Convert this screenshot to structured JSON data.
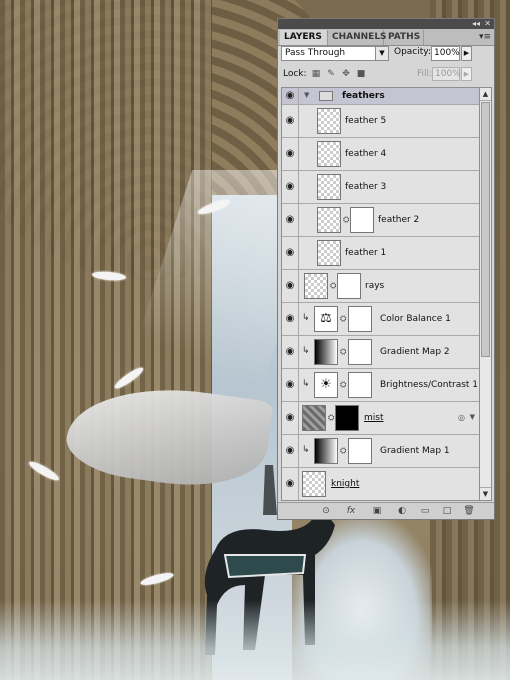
{
  "panel": {
    "tabs": [
      "LAYERS",
      "CHANNELS",
      "PATHS"
    ],
    "menu_icon": "▾≡",
    "topbar_icons": [
      "collapse-icon",
      "close-icon"
    ],
    "blend_mode": "Pass Through",
    "opacity_label": "Opacity:",
    "opacity_value": "100%",
    "lock_label": "Lock:",
    "lock_icons": [
      "lock-transparent-icon",
      "lock-image-icon",
      "lock-position-icon",
      "lock-all-icon"
    ],
    "fill_label": "Fill:",
    "fill_value": "100%",
    "bottom_icons": [
      "link-layers-icon",
      "fx-icon",
      "add-mask-icon",
      "adjustment-layer-icon",
      "new-group-icon",
      "new-layer-icon",
      "delete-icon"
    ],
    "bottom_glyphs": [
      "⊙",
      "fx",
      "▣",
      "◐",
      "▭",
      "□",
      "🗑"
    ]
  },
  "layers": {
    "group": {
      "name": "feathers"
    },
    "items": [
      {
        "name": "feather 5"
      },
      {
        "name": "feather 4"
      },
      {
        "name": "feather 3"
      },
      {
        "name": "feather 2"
      },
      {
        "name": "feather 1"
      },
      {
        "name": "rays"
      },
      {
        "name": "Color Balance 1"
      },
      {
        "name": "Gradient Map 2"
      },
      {
        "name": "Brightness/Contrast 1"
      },
      {
        "name": "mist"
      },
      {
        "name": "Gradient Map 1"
      },
      {
        "name": "knight"
      }
    ]
  }
}
